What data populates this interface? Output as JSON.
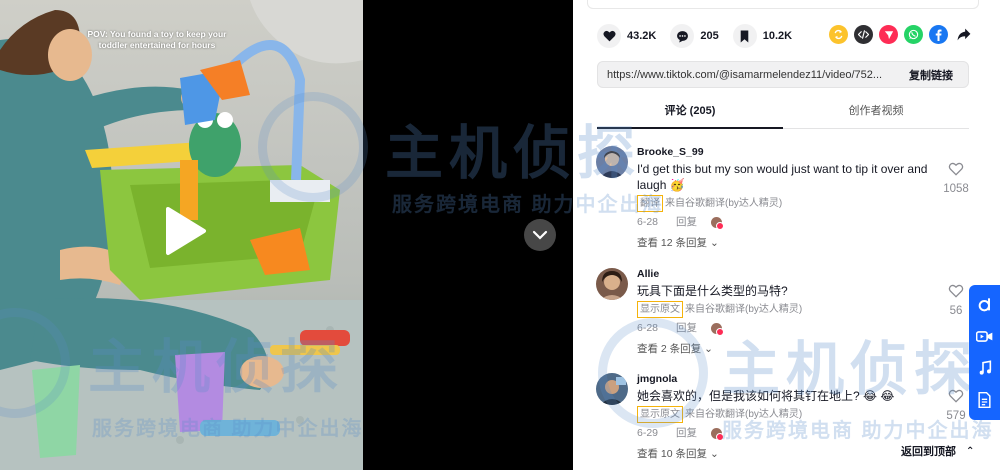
{
  "video": {
    "caption": "POV: You found a toy to keep your toddler entertained for hours"
  },
  "stats": {
    "likes": "43.2K",
    "comments": "205",
    "saves": "10.2K"
  },
  "share_icons": [
    "repost-icon",
    "embed-icon",
    "send-icon",
    "whatsapp-icon",
    "facebook-icon",
    "share-arrow-icon"
  ],
  "link": {
    "url": "https://www.tiktok.com/@isamarmelendez11/video/752...",
    "copy_label": "复制链接"
  },
  "tabs": {
    "comments": "评论 (205)",
    "creator_videos": "创作者视频"
  },
  "comments": [
    {
      "user": "Brooke_S_99",
      "text": "I'd get this but my son would just want to tip it over and laugh 🥳",
      "trans_action": "翻译",
      "trans_note": "来自谷歌翻译(by达人精灵)",
      "date": "6-28",
      "reply": "回复",
      "more": "查看 12 条回复",
      "likes": "1058",
      "avatar_color": "#6b7fa5"
    },
    {
      "user": "Allie",
      "text": "玩具下面是什么类型的马特?",
      "trans_action": "显示原文",
      "trans_note": "来自谷歌翻译(by达人精灵)",
      "date": "6-28",
      "reply": "回复",
      "more": "查看 2 条回复",
      "likes": "56",
      "avatar_color": "#7a5a4a"
    },
    {
      "user": "jmgnola",
      "text": "她会喜欢的，但是我该如何将其钉在地上? 😂 😂",
      "trans_action": "显示原文",
      "trans_note": "来自谷歌翻译(by达人精灵)",
      "date": "6-29",
      "reply": "回复",
      "more": "查看 10 条回复",
      "likes": "579",
      "avatar_color": "#4e6a88"
    }
  ],
  "watermark": {
    "logo_text": "主机侦探",
    "slogan": "服务跨境电商 助力中企出海"
  },
  "back_to_top": "返回到顶部",
  "colors": {
    "accent_blue": "#1565ff",
    "highlight_box": "#f5b30b",
    "facebook": "#1877f2",
    "whatsapp": "#25d366"
  }
}
